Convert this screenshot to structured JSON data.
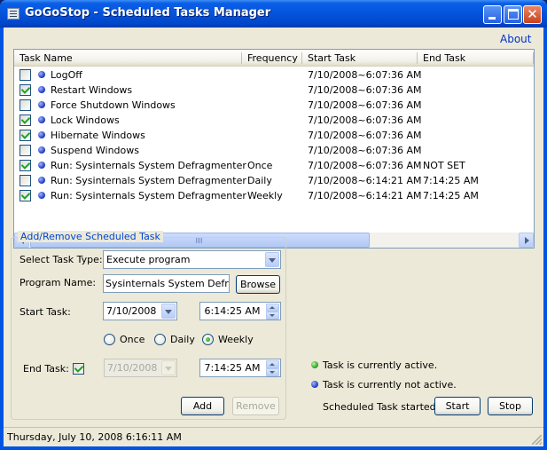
{
  "window": {
    "title": "GoGoStop - Scheduled Tasks Manager",
    "about_label": "About"
  },
  "task_list": {
    "columns": [
      "Task Name",
      "Frequency",
      "Start Task",
      "End Task"
    ],
    "rows": [
      {
        "checked": false,
        "status": "inactive",
        "name": "LogOff",
        "frequency": "",
        "start": "7/10/2008~6:07:36 AM",
        "end": ""
      },
      {
        "checked": true,
        "status": "inactive",
        "name": "Restart Windows",
        "frequency": "",
        "start": "7/10/2008~6:07:36 AM",
        "end": ""
      },
      {
        "checked": false,
        "status": "inactive",
        "name": "Force Shutdown Windows",
        "frequency": "",
        "start": "7/10/2008~6:07:36 AM",
        "end": ""
      },
      {
        "checked": true,
        "status": "inactive",
        "name": "Lock Windows",
        "frequency": "",
        "start": "7/10/2008~6:07:36 AM",
        "end": ""
      },
      {
        "checked": true,
        "status": "inactive",
        "name": "Hibernate Windows",
        "frequency": "",
        "start": "7/10/2008~6:07:36 AM",
        "end": ""
      },
      {
        "checked": false,
        "status": "inactive",
        "name": "Suspend Windows",
        "frequency": "",
        "start": "7/10/2008~6:07:36 AM",
        "end": ""
      },
      {
        "checked": true,
        "status": "inactive",
        "name": "Run: Sysinternals System Defragmenter",
        "frequency": "Once",
        "start": "7/10/2008~6:07:36 AM",
        "end": "NOT SET"
      },
      {
        "checked": false,
        "status": "inactive",
        "name": "Run: Sysinternals System Defragmenter",
        "frequency": "Daily",
        "start": "7/10/2008~6:14:21 AM",
        "end": "7:14:25 AM"
      },
      {
        "checked": true,
        "status": "inactive",
        "name": "Run: Sysinternals System Defragmenter",
        "frequency": "Weekly",
        "start": "7/10/2008~6:14:21 AM",
        "end": "7:14:25 AM"
      }
    ]
  },
  "form": {
    "group_title": "Add/Remove Scheduled Task",
    "task_type_label": "Select Task Type:",
    "task_type_value": "Execute program",
    "program_name_label": "Program Name:",
    "program_name_value": "Sysinternals System Defragmenter",
    "browse_label": "Browse",
    "start_task_label": "Start Task:",
    "start_date": "7/10/2008",
    "start_time": "6:14:25 AM",
    "frequency_options": [
      {
        "label": "Once",
        "selected": false
      },
      {
        "label": "Daily",
        "selected": false
      },
      {
        "label": "Weekly",
        "selected": true
      }
    ],
    "end_task_label": "End Task:",
    "end_task_checked": true,
    "end_date": "7/10/2008",
    "end_time": "7:14:25 AM",
    "add_label": "Add",
    "remove_label": "Remove"
  },
  "legend": {
    "active_text": "Task is currently active.",
    "inactive_text": "Task is currently not active.",
    "active_color": "#2a9a1a",
    "inactive_color": "#1a35b8"
  },
  "controls": {
    "status_text": "Scheduled Task started.",
    "start_label": "Start",
    "stop_label": "Stop"
  },
  "statusbar": {
    "text": "Thursday, July 10, 2008  6:16:11 AM"
  }
}
